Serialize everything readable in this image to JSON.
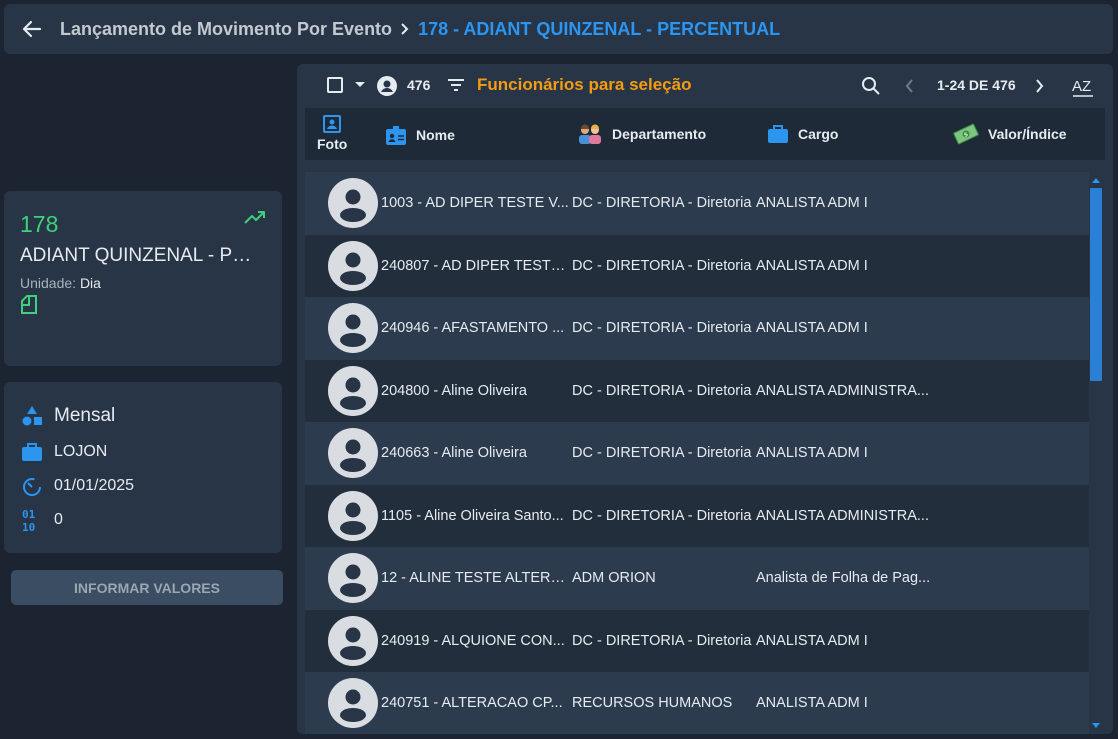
{
  "header": {
    "breadcrumb_parent": "Lançamento de Movimento Por Evento",
    "breadcrumb_current": "178 - ADIANT QUINZENAL - PERCENTUAL"
  },
  "event_card": {
    "code": "178",
    "name": "ADIANT QUINZENAL - PERCENTUAL",
    "unit_label": "Unidade:",
    "unit_value": "Dia"
  },
  "info_card": {
    "period": "Mensal",
    "company": "LOJON",
    "date": "01/01/2025",
    "value": "0"
  },
  "informar_button": "INFORMAR VALORES",
  "toolbar": {
    "count": "476",
    "title": "Funcionários para seleção",
    "pagination": "1-24 DE 476",
    "sort_label": "AZ"
  },
  "columns": {
    "foto": "Foto",
    "nome": "Nome",
    "departamento": "Departamento",
    "cargo": "Cargo",
    "valor": "Valor/Índice"
  },
  "rows": [
    {
      "nome": "1003 - AD DIPER TESTE V...",
      "departamento": "DC - DIRETORIA - Diretoria",
      "cargo": "ANALISTA ADM I"
    },
    {
      "nome": "240807 - AD DIPER TESTE...",
      "departamento": "DC - DIRETORIA - Diretoria",
      "cargo": "ANALISTA ADM I"
    },
    {
      "nome": "240946 - AFASTAMENTO ...",
      "departamento": "DC - DIRETORIA - Diretoria",
      "cargo": "ANALISTA ADM I"
    },
    {
      "nome": "204800 - Aline Oliveira",
      "departamento": "DC - DIRETORIA - Diretoria",
      "cargo": "ANALISTA ADMINISTRA..."
    },
    {
      "nome": "240663 - Aline Oliveira",
      "departamento": "DC - DIRETORIA - Diretoria",
      "cargo": "ANALISTA ADM I"
    },
    {
      "nome": "1105 - Aline Oliveira Santo...",
      "departamento": "DC - DIRETORIA - Diretoria",
      "cargo": "ANALISTA ADMINISTRA..."
    },
    {
      "nome": "12 - ALINE TESTE ALTERA...",
      "departamento": "ADM ORION",
      "cargo": "Analista de Folha de Pag..."
    },
    {
      "nome": "240919 - ALQUIONE CON...",
      "departamento": "DC - DIRETORIA - Diretoria",
      "cargo": "ANALISTA ADM I"
    },
    {
      "nome": "240751 - ALTERACAO CP...",
      "departamento": "RECURSOS HUMANOS",
      "cargo": "ANALISTA ADM I"
    }
  ],
  "colors": {
    "accent_blue": "#2b95f0",
    "title_orange": "#f39c12",
    "code_green": "#3ed07a"
  }
}
